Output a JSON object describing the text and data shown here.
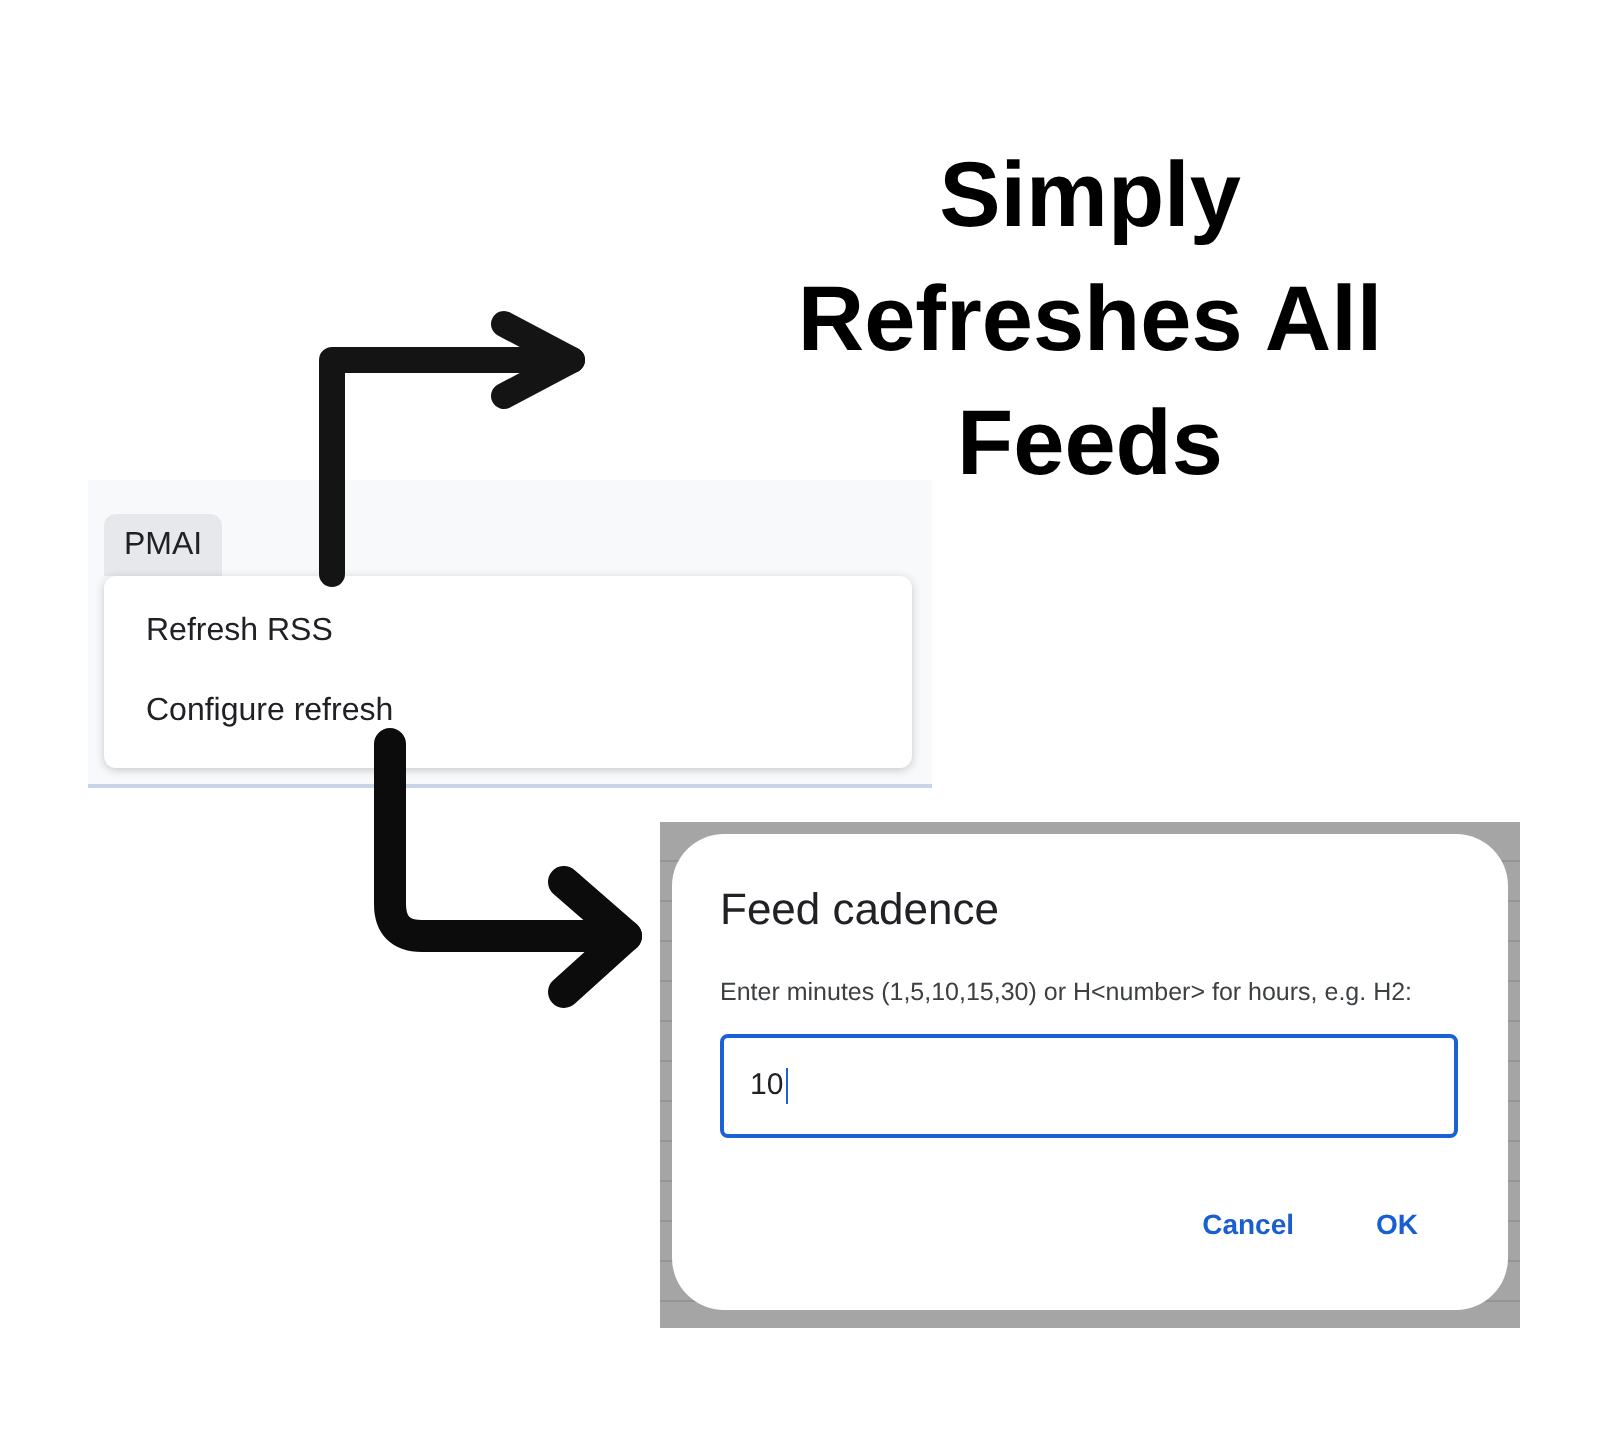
{
  "caption": {
    "text": "Simply Refreshes All Feeds"
  },
  "menu": {
    "label": "PMAI",
    "expanded": true,
    "items": [
      {
        "label": "Refresh RSS"
      },
      {
        "label": "Configure refresh"
      }
    ]
  },
  "dialog": {
    "title": "Feed cadence",
    "message": "Enter minutes (1,5,10,15,30) or H<number> for hours, e.g. H2:",
    "input": {
      "value": "10",
      "focused": true
    },
    "buttons": [
      {
        "label": "Cancel"
      },
      {
        "label": "OK"
      }
    ]
  }
}
